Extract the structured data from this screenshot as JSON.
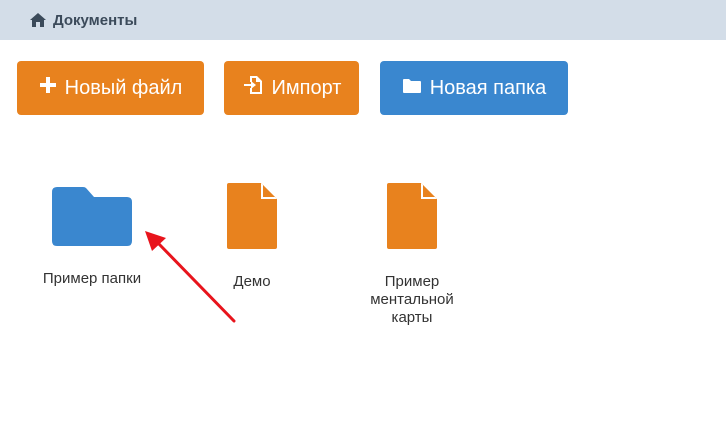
{
  "breadcrumb": {
    "icon": "home-icon",
    "title": "Документы"
  },
  "toolbar": {
    "new_file_label": "Новый файл",
    "import_label": "Импорт",
    "new_folder_label": "Новая папка"
  },
  "items": [
    {
      "type": "folder",
      "icon": "folder-icon",
      "label": "Пример папки"
    },
    {
      "type": "file",
      "icon": "file-icon",
      "label": "Демо"
    },
    {
      "type": "file",
      "icon": "file-icon",
      "label_lines": [
        "Пример",
        "ментальной",
        "карты"
      ]
    }
  ],
  "colors": {
    "orange": "#e8821e",
    "blue": "#3a87cf",
    "header": "#d3dde8",
    "annotation": "#e8141c"
  }
}
